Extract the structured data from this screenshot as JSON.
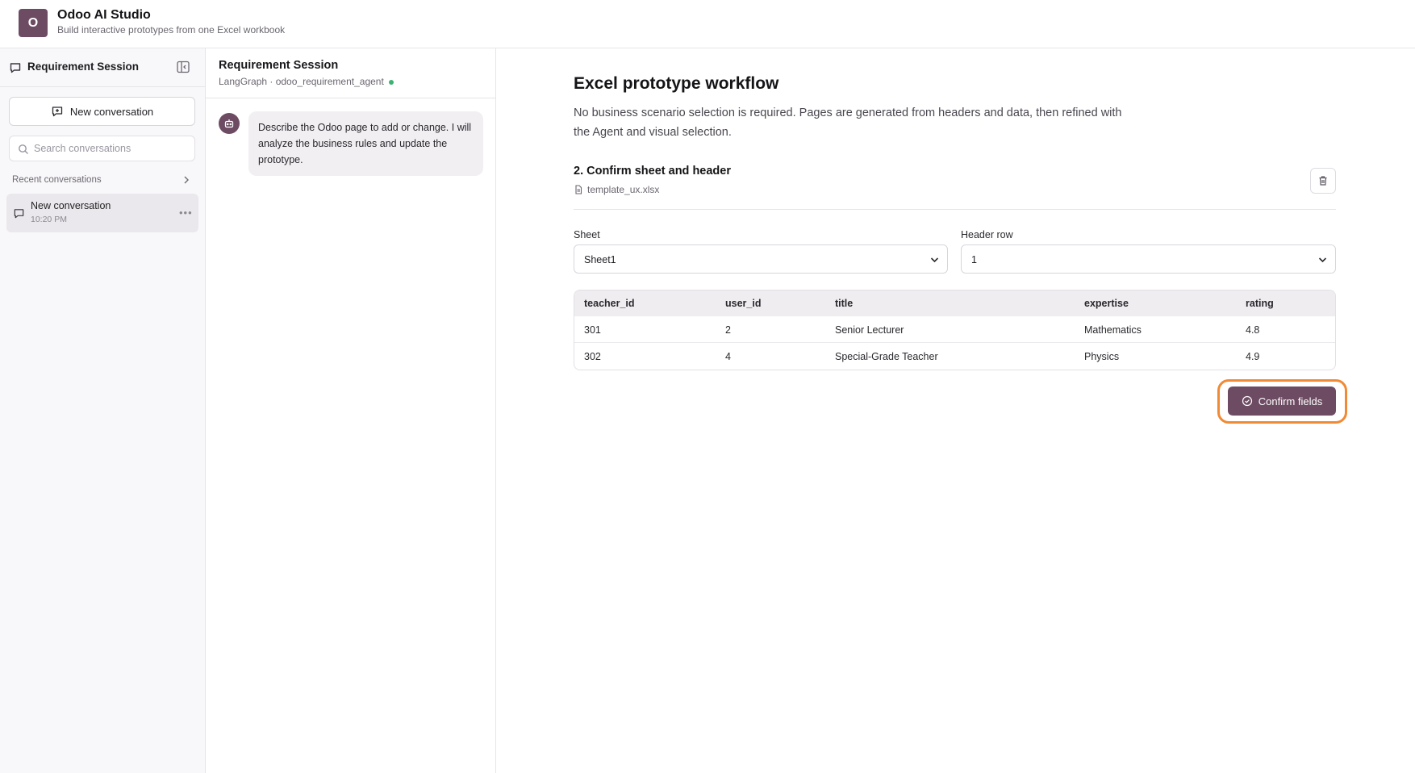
{
  "app": {
    "logo_letter": "O",
    "title": "Odoo AI Studio",
    "subtitle": "Build interactive prototypes from one Excel workbook"
  },
  "sidebar": {
    "title": "Requirement Session",
    "new_conversation_label": "New conversation",
    "search_placeholder": "Search conversations",
    "recent_label": "Recent conversations",
    "conversations": [
      {
        "title": "New conversation",
        "time": "10:20 PM"
      }
    ]
  },
  "chat": {
    "title": "Requirement Session",
    "subtitle": "LangGraph · odoo_requirement_agent",
    "status_color": "#3cb371",
    "messages": [
      {
        "role": "assistant",
        "text": "Describe the Odoo page to add or change. I will analyze the business rules and update the prototype."
      }
    ]
  },
  "workflow": {
    "title": "Excel prototype workflow",
    "description": "No business scenario selection is required. Pages are generated from headers and data, then refined with the Agent and visual selection.",
    "step_title": "2. Confirm sheet and header",
    "file_name": "template_ux.xlsx",
    "sheet_label": "Sheet",
    "sheet_value": "Sheet1",
    "header_row_label": "Header row",
    "header_row_value": "1",
    "table": {
      "columns": [
        "teacher_id",
        "user_id",
        "title",
        "expertise",
        "rating"
      ],
      "rows": [
        [
          "301",
          "2",
          "Senior Lecturer",
          "Mathematics",
          "4.8"
        ],
        [
          "302",
          "4",
          "Special-Grade Teacher",
          "Physics",
          "4.9"
        ]
      ]
    },
    "confirm_label": "Confirm fields"
  },
  "colors": {
    "brand": "#6d4c63",
    "highlight": "#f08a35"
  }
}
